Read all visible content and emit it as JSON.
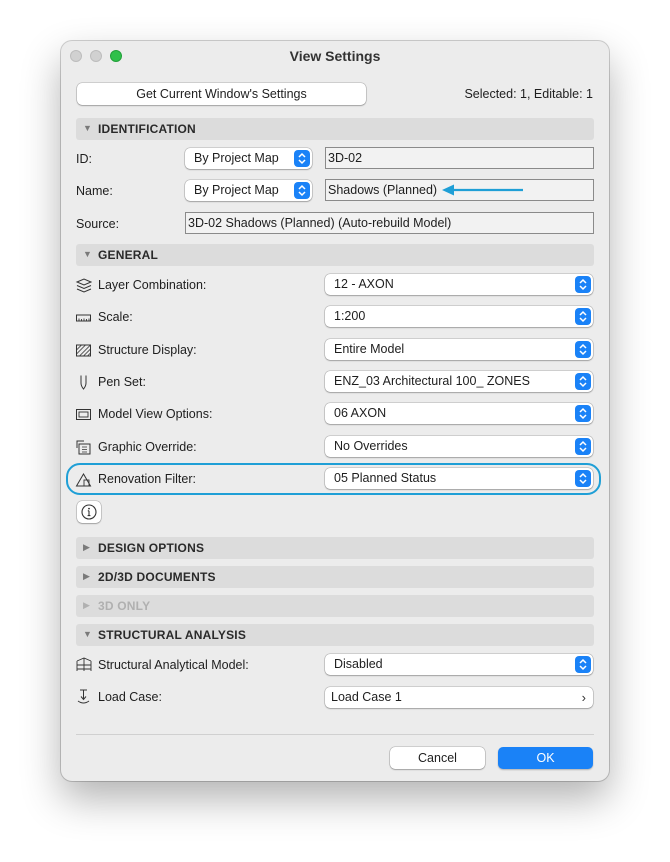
{
  "window": {
    "title": "View Settings"
  },
  "header": {
    "get_settings_label": "Get Current Window's Settings",
    "selection_status": "Selected: 1, Editable: 1"
  },
  "identification": {
    "title": "IDENTIFICATION",
    "id_label": "ID:",
    "id_mode": "By Project Map",
    "id_value": "3D-02",
    "name_label": "Name:",
    "name_mode": "By Project Map",
    "name_value": "Shadows (Planned)",
    "source_label": "Source:",
    "source_value": "3D-02 Shadows (Planned) (Auto-rebuild Model)"
  },
  "general": {
    "title": "GENERAL",
    "rows": [
      {
        "label": "Layer Combination:",
        "value": "12 - AXON",
        "icon": "layers-icon"
      },
      {
        "label": "Scale:",
        "value": "1:200",
        "icon": "ruler-icon"
      },
      {
        "label": "Structure Display:",
        "value": "Entire Model",
        "icon": "hatch-icon"
      },
      {
        "label": "Pen Set:",
        "value": "ENZ_03 Architectural 100_ ZONES",
        "icon": "pen-icon"
      },
      {
        "label": "Model View Options:",
        "value": "06 AXON",
        "icon": "window-icon"
      },
      {
        "label": "Graphic Override:",
        "value": "No Overrides",
        "icon": "override-icon"
      },
      {
        "label": "Renovation Filter:",
        "value": "05 Planned Status",
        "icon": "renovation-icon"
      }
    ]
  },
  "sections": {
    "design_options": "DESIGN OPTIONS",
    "documents": "2D/3D DOCUMENTS",
    "only_3d": "3D ONLY"
  },
  "structural": {
    "title": "STRUCTURAL ANALYSIS",
    "model_label": "Structural Analytical Model:",
    "model_value": "Disabled",
    "load_label": "Load Case:",
    "load_value": "Load Case 1"
  },
  "footer": {
    "cancel_label": "Cancel",
    "ok_label": "OK"
  },
  "colors": {
    "accent": "#1a82f7",
    "highlight": "#1f9fd6",
    "close_light": "#d1d1d1",
    "zoom_light": "#2fc04a"
  }
}
